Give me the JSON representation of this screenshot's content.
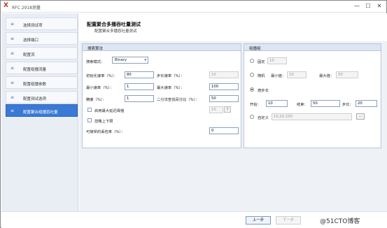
{
  "window": {
    "title": "RFC 2918测量",
    "app_icon": "X",
    "minimize": "—",
    "maximize": "☐",
    "close": "✕"
  },
  "sidebar": {
    "items": [
      {
        "label": "选择测试项",
        "icon": "list-icon"
      },
      {
        "label": "选择端口",
        "icon": "list-icon"
      },
      {
        "label": "配置流",
        "icon": "list-icon"
      },
      {
        "label": "配置组播流量",
        "icon": "list-icon"
      },
      {
        "label": "配置组播参数",
        "icon": "list-icon"
      },
      {
        "label": "配置测试选项",
        "icon": "list-icon"
      },
      {
        "label": "配置聚合组播吞吐量",
        "icon": "list-icon"
      }
    ],
    "active_index": 6,
    "icon_glyph": "≡"
  },
  "main": {
    "title": "配置聚合多播吞吐量测试",
    "subtitle": "配置聚合多播吞吐量测试"
  },
  "search_panel": {
    "title": "搜索算法",
    "mode_label": "搜索模式:",
    "mode_value": "Binary",
    "initial_rate_label": "初始化速率（%）：",
    "initial_rate_value": "80",
    "step_rate_label": "步长速率（%）：",
    "step_rate_value": "10",
    "min_rate_label": "最小速率（%）：",
    "min_rate_value": "1",
    "max_rate_label": "最大速率（%）：",
    "max_rate_value": "100",
    "precision_label": "精度（%）：",
    "precision_value": "1",
    "binary_percent_label": "二分法查找百分比（%）：",
    "binary_percent_value": "50",
    "use_max_rate_label": "启用最大延迟阈值",
    "use_max_rate_value": "10",
    "ignore_bounds_label": "忽略上下限",
    "loss_rate_label": "可接受的丢包率（%）：",
    "loss_rate_value": "0"
  },
  "group_panel": {
    "title": "组播组",
    "fixed_label": "固定",
    "fixed_value": "10",
    "random_label": "随机",
    "random_min_label": "最小值：",
    "random_min_value": "10",
    "random_max_label": "最大值：",
    "random_max_value": "50",
    "step_label": "按步长",
    "start_label": "开始：",
    "start_value": "10",
    "end_label": "结束：",
    "end_value": "50",
    "step_size_label": "步长：",
    "step_size_value": "20",
    "custom_label": "自定义",
    "custom_value": "10,20,100",
    "browse_label": "..."
  },
  "footer": {
    "prev_label": "上一步",
    "next_label": "下一步",
    "watermark": "@51CTO博客"
  }
}
